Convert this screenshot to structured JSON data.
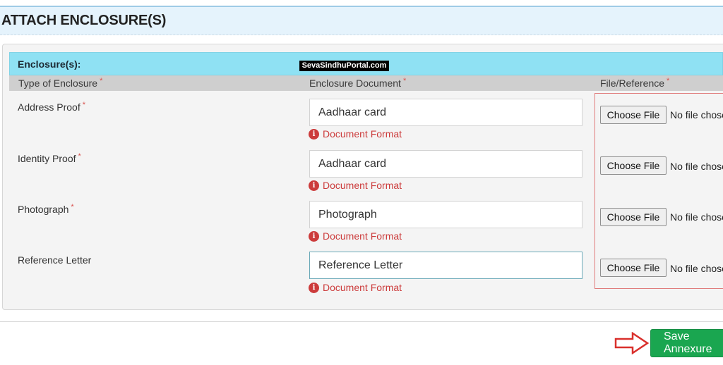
{
  "header": {
    "title": "ATTACH ENCLOSURE(S)"
  },
  "panel": {
    "title": "Enclosure(s):"
  },
  "watermark": "SevaSindhuPortal.com",
  "columns": {
    "type": "Type of Enclosure",
    "document": "Enclosure Document",
    "file": "File/Reference",
    "required_mark": "*"
  },
  "rows": [
    {
      "label": "Address Proof",
      "required": "*",
      "document": "Aadhaar card",
      "format_link": "Document Format",
      "choose_label": "Choose File",
      "file_status": "No file chosen"
    },
    {
      "label": "Identity Proof",
      "required": "*",
      "document": "Aadhaar card",
      "format_link": "Document Format",
      "choose_label": "Choose File",
      "file_status": "No file chosen"
    },
    {
      "label": "Photograph",
      "required": "*",
      "document": "Photograph",
      "format_link": "Document Format",
      "choose_label": "Choose File",
      "file_status": "No file chosen"
    },
    {
      "label": "Reference Letter",
      "required": "",
      "document": "Reference Letter",
      "format_link": "Document Format",
      "choose_label": "Choose File",
      "file_status": "No file chosen"
    }
  ],
  "info_icon_glyph": "i",
  "actions": {
    "save_label": "Save Annexure"
  },
  "colors": {
    "save": "#1aa650",
    "arrow": "#d9302c",
    "required": "#d9534f"
  },
  "icons": {
    "info": "info-circle-icon",
    "pointer": "right-arrow-icon"
  }
}
